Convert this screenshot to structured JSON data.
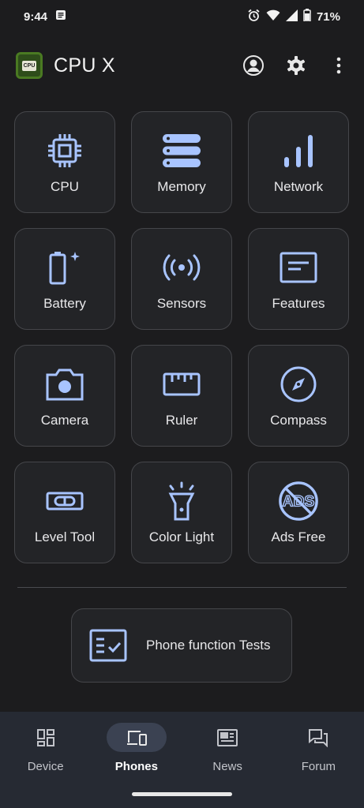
{
  "status_bar": {
    "time": "9:44",
    "battery": "71%"
  },
  "app": {
    "title": "CPU X",
    "logo_text": "CPU"
  },
  "tiles": [
    {
      "label": "CPU",
      "icon": "chip-icon"
    },
    {
      "label": "Memory",
      "icon": "memory-icon"
    },
    {
      "label": "Network",
      "icon": "signal-bars-icon"
    },
    {
      "label": "Battery",
      "icon": "battery-icon"
    },
    {
      "label": "Sensors",
      "icon": "sensors-icon"
    },
    {
      "label": "Features",
      "icon": "features-icon"
    },
    {
      "label": "Camera",
      "icon": "camera-icon"
    },
    {
      "label": "Ruler",
      "icon": "ruler-icon"
    },
    {
      "label": "Compass",
      "icon": "compass-icon"
    },
    {
      "label": "Level Tool",
      "icon": "level-icon"
    },
    {
      "label": "Color Light",
      "icon": "flashlight-icon"
    },
    {
      "label": "Ads Free",
      "icon": "ads-blocked-icon",
      "icon_text": "ADS"
    }
  ],
  "tests": {
    "label": "Phone function Tests"
  },
  "nav": [
    {
      "label": "Device",
      "active": false
    },
    {
      "label": "Phones",
      "active": true
    },
    {
      "label": "News",
      "active": false
    },
    {
      "label": "Forum",
      "active": false
    }
  ],
  "colors": {
    "accent": "#a8c4ff",
    "background": "#1c1c1e",
    "tile": "#232427",
    "nav": "#262a33"
  }
}
